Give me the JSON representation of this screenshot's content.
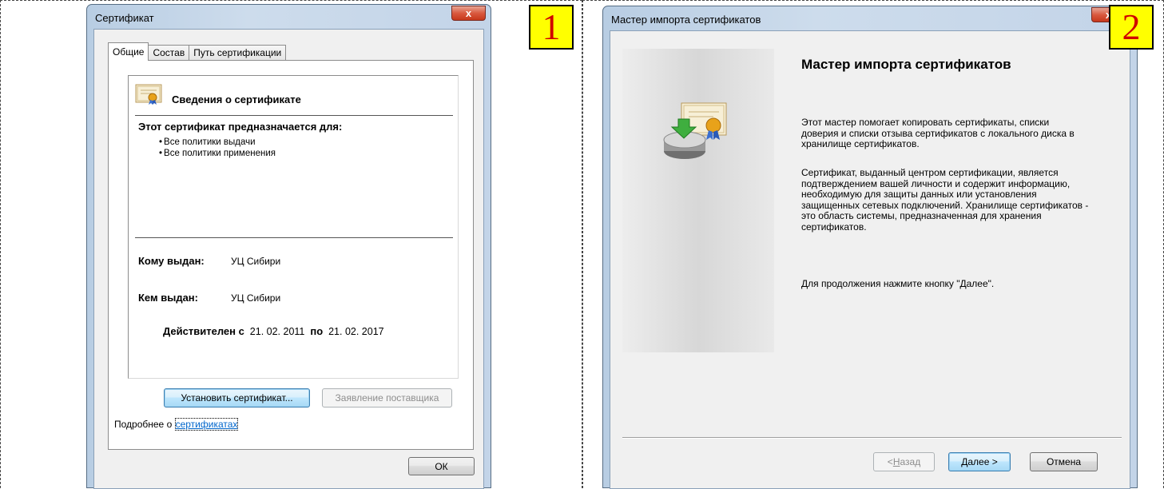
{
  "badges": {
    "one": "1",
    "two": "2"
  },
  "certificate_dialog": {
    "title": "Сертификат",
    "close_glyph": "x",
    "tabs": [
      {
        "label": "Общие"
      },
      {
        "label": "Состав"
      },
      {
        "label": "Путь сертификации"
      }
    ],
    "info_title": "Сведения о сертификате",
    "purpose_heading": "Этот сертификат предназначается для:",
    "purposes": [
      "Все политики выдачи",
      "Все политики применения"
    ],
    "issued_to_label": "Кому выдан:",
    "issued_to_value": "УЦ Сибири",
    "issued_by_label": "Кем выдан:",
    "issued_by_value": "УЦ Сибири",
    "valid_from_label": "Действителен с",
    "valid_from_value": "21. 02. 2011",
    "valid_to_label": "по",
    "valid_to_value": "21. 02. 2017",
    "install_button": "Установить сертификат...",
    "issuer_statement_button": "Заявление поставщика",
    "more_info_prefix": "Подробнее о",
    "more_info_link": "сертификатах",
    "ok_button": "ОК",
    "icon": "certificate-icon"
  },
  "import_wizard": {
    "title": "Мастер импорта сертификатов",
    "heading": "Мастер импорта сертификатов",
    "paragraph1": "Этот мастер помогает копировать сертификаты, списки доверия и списки отзыва сертификатов с локального диска в хранилище сертификатов.",
    "paragraph2": "Сертификат, выданный центром сертификации, является подтверждением вашей личности и содержит информацию, необходимую для защиты данных или установления защищенных сетевых подключений. Хранилище сертификатов - это область системы, предназначенная для хранения сертификатов.",
    "paragraph3": "Для продолжения нажмите кнопку \"Далее\".",
    "back_button_prefix": "< ",
    "back_button_mnemonic": "Н",
    "back_button_rest": "азад",
    "next_button": "Далее >",
    "cancel_button": "Отмена",
    "icon": "certificate-disk-install-icon"
  },
  "colors": {
    "badge_bg": "#ffff00",
    "badge_text": "#d00000",
    "close_button": "#c7381c",
    "link": "#0066cc"
  }
}
